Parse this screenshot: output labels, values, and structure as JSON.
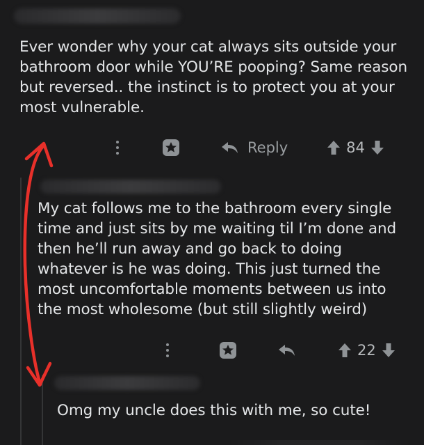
{
  "comments": [
    {
      "text": "Ever wonder why your cat always sits outside your bathroom door while YOU’RE pooping? Same reason but reversed.. the instinct is to protect you at your most vulnerable.",
      "reply_label": "Reply",
      "score": "84"
    },
    {
      "text": "My cat follows me to the bathroom every single time and just sits by me waiting til I’m done and then he’ll run away and go back to doing whatever is he was doing. This just turned the most uncomfortable moments between us into the most wholesome (but still slightly weird)",
      "score": "22"
    },
    {
      "text": "Omg my uncle does this with me, so cute!"
    }
  ],
  "icons": {
    "more": "more-dots-icon",
    "award": "award-icon",
    "reply": "reply-arrow-icon",
    "upvote": "upvote-icon",
    "downvote": "downvote-icon"
  },
  "colors": {
    "background": "#1b1b1c",
    "annotation": "#e8302a"
  }
}
